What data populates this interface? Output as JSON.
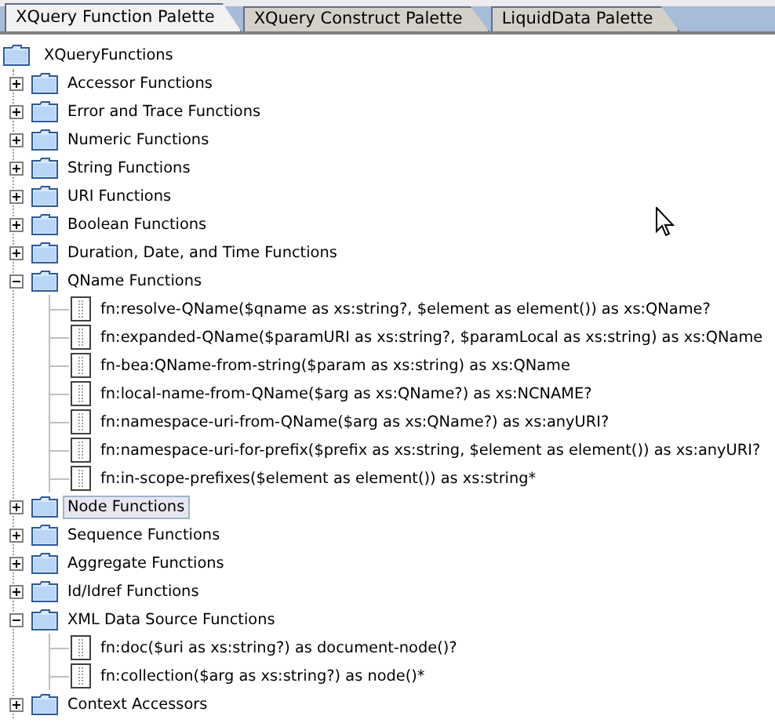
{
  "tabs": [
    {
      "label": "XQuery Function Palette",
      "selected": true
    },
    {
      "label": "XQuery Construct Palette",
      "selected": false
    },
    {
      "label": "LiquidData Palette",
      "selected": false
    }
  ],
  "tree": {
    "label": "XQueryFunctions",
    "selected": false,
    "children": [
      {
        "label": "Accessor Functions",
        "kind": "folder",
        "expanded": false,
        "selected": false
      },
      {
        "label": "Error and Trace Functions",
        "kind": "folder",
        "expanded": false,
        "selected": false
      },
      {
        "label": "Numeric Functions",
        "kind": "folder",
        "expanded": false,
        "selected": false
      },
      {
        "label": "String Functions",
        "kind": "folder",
        "expanded": false,
        "selected": false
      },
      {
        "label": "URI Functions",
        "kind": "folder",
        "expanded": false,
        "selected": false
      },
      {
        "label": "Boolean Functions",
        "kind": "folder",
        "expanded": false,
        "selected": false
      },
      {
        "label": "Duration, Date, and Time Functions",
        "kind": "folder",
        "expanded": false,
        "selected": false
      },
      {
        "label": "QName Functions",
        "kind": "folder",
        "expanded": true,
        "selected": false,
        "children": [
          {
            "label": "fn:resolve-QName($qname as xs:string?, $element as element()) as xs:QName?",
            "kind": "function",
            "selected": false
          },
          {
            "label": "fn:expanded-QName($paramURI as xs:string?, $paramLocal as xs:string) as xs:QName",
            "kind": "function",
            "selected": false
          },
          {
            "label": "fn-bea:QName-from-string($param as xs:string) as xs:QName",
            "kind": "function",
            "selected": false
          },
          {
            "label": "fn:local-name-from-QName($arg as xs:QName?) as xs:NCNAME?",
            "kind": "function",
            "selected": false
          },
          {
            "label": "fn:namespace-uri-from-QName($arg as xs:QName?) as xs:anyURI?",
            "kind": "function",
            "selected": false
          },
          {
            "label": "fn:namespace-uri-for-prefix($prefix as xs:string, $element as element()) as xs:anyURI?",
            "kind": "function",
            "selected": false
          },
          {
            "label": "fn:in-scope-prefixes($element as element()) as xs:string*",
            "kind": "function",
            "selected": false
          }
        ]
      },
      {
        "label": "Node Functions",
        "kind": "folder",
        "expanded": false,
        "selected": true
      },
      {
        "label": "Sequence Functions",
        "kind": "folder",
        "expanded": false,
        "selected": false
      },
      {
        "label": "Aggregate Functions",
        "kind": "folder",
        "expanded": false,
        "selected": false
      },
      {
        "label": "Id/Idref Functions",
        "kind": "folder",
        "expanded": false,
        "selected": false
      },
      {
        "label": "XML Data Source Functions",
        "kind": "folder",
        "expanded": true,
        "selected": false,
        "children": [
          {
            "label": "fn:doc($uri as xs:string?) as document-node()?",
            "kind": "function",
            "selected": false
          },
          {
            "label": "fn:collection($arg as xs:string?) as node()*",
            "kind": "function",
            "selected": false
          }
        ]
      },
      {
        "label": "Context Accessors",
        "kind": "folder",
        "expanded": false,
        "selected": false
      }
    ]
  }
}
